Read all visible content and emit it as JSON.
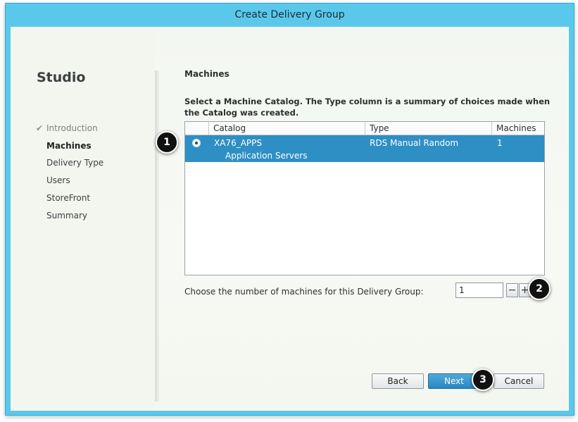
{
  "window": {
    "title": "Create Delivery Group"
  },
  "sidebar": {
    "title": "Studio",
    "steps": [
      {
        "label": "Introduction",
        "state": "done"
      },
      {
        "label": "Machines",
        "state": "current"
      },
      {
        "label": "Delivery Type",
        "state": "pending"
      },
      {
        "label": "Users",
        "state": "pending"
      },
      {
        "label": "StoreFront",
        "state": "pending"
      },
      {
        "label": "Summary",
        "state": "pending"
      }
    ],
    "check_glyph": "✔"
  },
  "main": {
    "section_title": "Machines",
    "instruction": "Select a Machine Catalog. The Type column is a summary of choices made when the Catalog was created.",
    "table": {
      "columns": [
        "Catalog",
        "Type",
        "Machines"
      ],
      "rows": [
        {
          "catalog": "XA76_APPS",
          "description": "Application Servers",
          "type": "RDS Manual Random",
          "machines": "1",
          "selected": true
        }
      ]
    },
    "count_label": "Choose the number of machines for this Delivery Group:",
    "count_value": "1",
    "decrement_label": "−",
    "increment_label": "+"
  },
  "footer": {
    "back_label": "Back",
    "next_label": "Next",
    "cancel_label": "Cancel"
  },
  "annotations": [
    "1",
    "2",
    "3"
  ],
  "colors": {
    "titlebar": "#5ac8eb",
    "selected_row": "#2e8fc4",
    "primary_button": "#2a86c0"
  }
}
